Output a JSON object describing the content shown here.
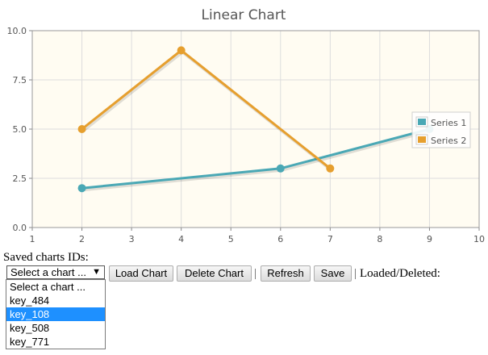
{
  "chart_data": {
    "type": "line",
    "title": "Linear Chart",
    "xlim": [
      1,
      10
    ],
    "ylim": [
      0,
      10
    ],
    "x_ticks": [
      "1",
      "2",
      "3",
      "4",
      "5",
      "6",
      "7",
      "8",
      "9",
      "10"
    ],
    "y_ticks": [
      "0.0",
      "2.5",
      "5.0",
      "7.5",
      "10.0"
    ],
    "grid": true,
    "legend_position": "right",
    "series": [
      {
        "name": "Series 1",
        "color": "#4aa8b5",
        "points": [
          [
            2,
            2
          ],
          [
            6,
            3
          ],
          [
            9,
            5
          ]
        ]
      },
      {
        "name": "Series 2",
        "color": "#e69f2e",
        "points": [
          [
            2,
            5
          ],
          [
            4,
            9
          ],
          [
            7,
            3
          ]
        ]
      }
    ]
  },
  "controls": {
    "saved_label": "Saved charts IDs:",
    "select_value": "Select a chart ...",
    "options": [
      "Select a chart ...",
      "key_484",
      "key_108",
      "key_508",
      "key_771"
    ],
    "selected_option": "key_108",
    "load_button": "Load Chart",
    "delete_button": "Delete Chart",
    "refresh_button": "Refresh",
    "save_button": "Save",
    "separator": "|",
    "status_label": "Loaded/Deleted:"
  }
}
